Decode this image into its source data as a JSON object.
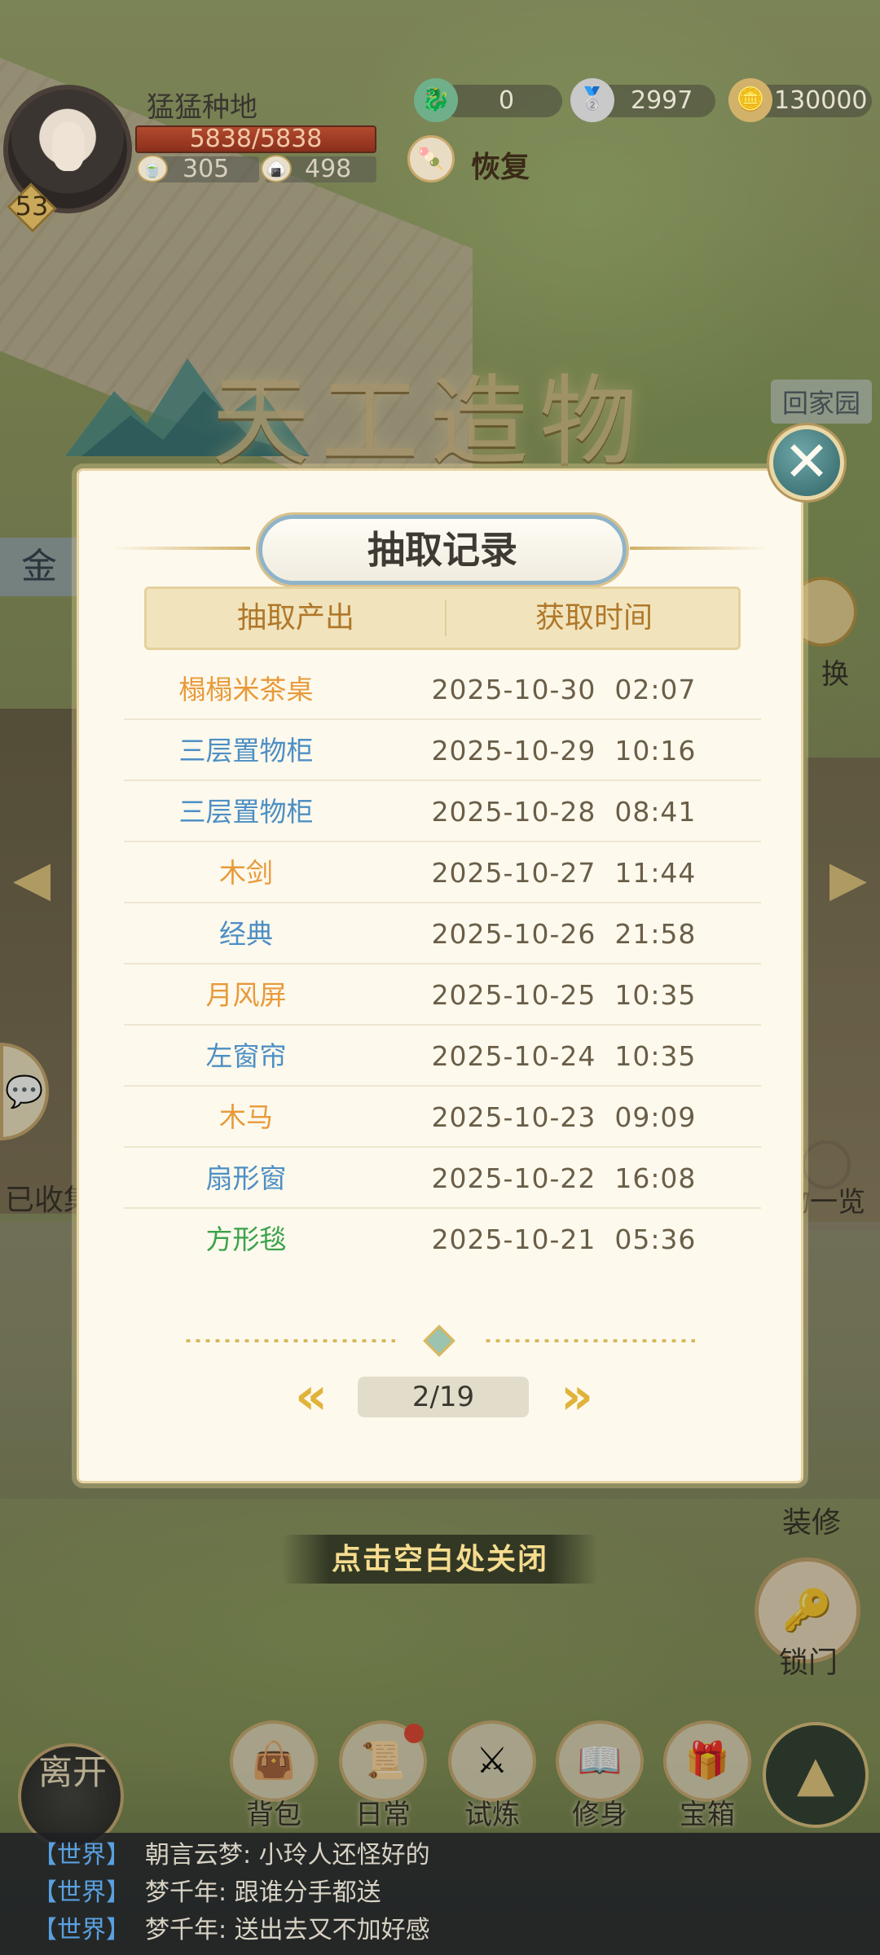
{
  "player": {
    "name": "猛猛种地",
    "level": "53",
    "hp": "5838/5838",
    "stamina": "305",
    "food": "498"
  },
  "resources": {
    "jade": "0",
    "silver": "2997",
    "coins": "130000",
    "restore_label": "恢复"
  },
  "banner": {
    "title": "天工造物",
    "home_tag": "回家园"
  },
  "side": {
    "left_label": "金",
    "collected_label": "已收集",
    "exchange_label": "换",
    "list_label": "物一览",
    "decor_label": "装修",
    "lock_label": "锁门"
  },
  "modal": {
    "title": "抽取记录",
    "col_item": "抽取产出",
    "col_time": "获取时间",
    "rows": [
      {
        "item": "榻榻米茶桌",
        "time": "2025-10-30  02:07",
        "color": "#e89a3a"
      },
      {
        "item": "三层置物柜",
        "time": "2025-10-29  10:16",
        "color": "#4d8fc4"
      },
      {
        "item": "三层置物柜",
        "time": "2025-10-28  08:41",
        "color": "#4d8fc4"
      },
      {
        "item": "木剑",
        "time": "2025-10-27  11:44",
        "color": "#e89a3a"
      },
      {
        "item": "经典",
        "time": "2025-10-26  21:58",
        "color": "#4d8fc4"
      },
      {
        "item": "月风屏",
        "time": "2025-10-25  10:35",
        "color": "#e89a3a"
      },
      {
        "item": "左窗帘",
        "time": "2025-10-24  10:35",
        "color": "#4d8fc4"
      },
      {
        "item": "木马",
        "time": "2025-10-23  09:09",
        "color": "#e89a3a"
      },
      {
        "item": "扇形窗",
        "time": "2025-10-22  16:08",
        "color": "#4d8fc4"
      },
      {
        "item": "方形毯",
        "time": "2025-10-21  05:36",
        "color": "#3aa34a"
      }
    ],
    "page": "2/19",
    "prev_icon": "double-chevron-left",
    "next_icon": "double-chevron-right",
    "close_icon": "close-x"
  },
  "hint": "点击空白处关闭",
  "nav": {
    "leave": "离开",
    "items": [
      {
        "label": "背包",
        "icon": "bag-icon"
      },
      {
        "label": "日常",
        "icon": "daily-icon"
      },
      {
        "label": "试炼",
        "icon": "trial-icon"
      },
      {
        "label": "修身",
        "icon": "cultivate-icon"
      },
      {
        "label": "宝箱",
        "icon": "chest-icon"
      }
    ]
  },
  "chat": [
    {
      "channel": "【世界】",
      "text": "朝言云梦: 小玲人还怪好的"
    },
    {
      "channel": "【世界】",
      "text": "梦千年: 跟谁分手都送"
    },
    {
      "channel": "【世界】",
      "text": "梦千年: 送出去又不加好感"
    }
  ]
}
